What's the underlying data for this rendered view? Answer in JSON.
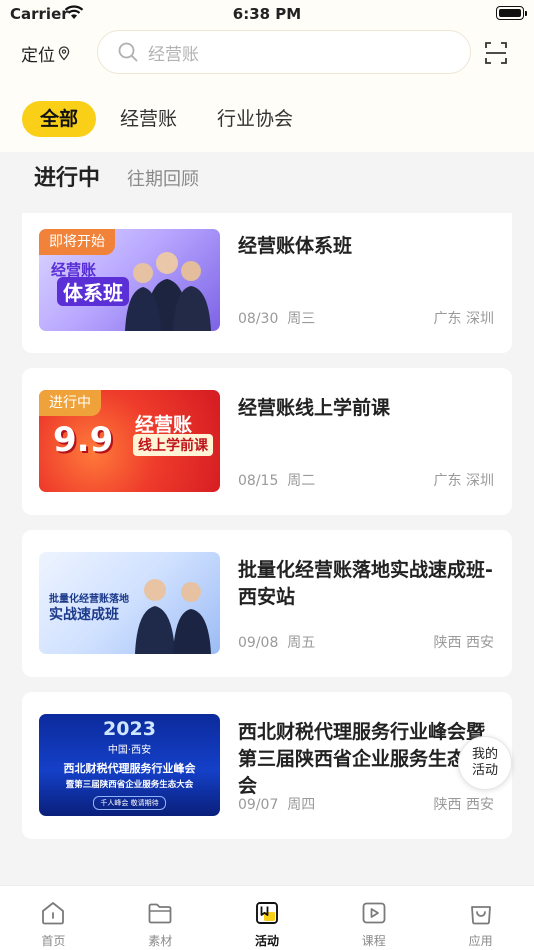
{
  "status_bar": {
    "carrier": "Carrier",
    "time": "6:38 PM"
  },
  "header": {
    "location_label": "定位",
    "search_placeholder": "经营账",
    "tabs": [
      {
        "label": "全部",
        "active": true
      },
      {
        "label": "经营账",
        "active": false
      },
      {
        "label": "行业协会",
        "active": false
      }
    ]
  },
  "subtabs": {
    "active": "进行中",
    "other": "往期回顾"
  },
  "events": [
    {
      "title": "经营账体系班",
      "date": "08/30",
      "weekday": "周三",
      "province": "广东",
      "city": "深圳",
      "badge": "即将开始",
      "thumb_text": [
        "经营账",
        "体系班"
      ]
    },
    {
      "title": "经营账线上学前课",
      "date": "08/15",
      "weekday": "周二",
      "province": "广东",
      "city": "深圳",
      "badge": "进行中",
      "thumb_text": [
        "9.9",
        "经营账",
        "线上学前课"
      ]
    },
    {
      "title": "批量化经营账落地实战速成班-西安站",
      "date": "09/08",
      "weekday": "周五",
      "province": "陕西",
      "city": "西安",
      "badge": "",
      "thumb_text": [
        "批量化经营账落地",
        "实战速成班"
      ]
    },
    {
      "title": "西北财税代理服务行业峰会暨第三届陕西省企业服务生态大会",
      "date": "09/07",
      "weekday": "周四",
      "province": "陕西",
      "city": "西安",
      "badge": "",
      "thumb_text": [
        "2023",
        "中国·西安",
        "西北财税代理服务行业峰会",
        "暨第三届陕西省企业服务生态大会",
        "千人峰会 敬请期待"
      ]
    }
  ],
  "floating_button": {
    "line1": "我的",
    "line2": "活动"
  },
  "tab_bar": [
    {
      "label": "首页",
      "icon": "home-icon",
      "active": false
    },
    {
      "label": "素材",
      "icon": "folder-icon",
      "active": false
    },
    {
      "label": "活动",
      "icon": "activity-icon",
      "active": true
    },
    {
      "label": "课程",
      "icon": "play-icon",
      "active": false
    },
    {
      "label": "应用",
      "icon": "bag-icon",
      "active": false
    }
  ],
  "colors": {
    "accent": "#f9cf18",
    "badge_red": "#e9553a",
    "badge_orange": "#f0a23a"
  }
}
